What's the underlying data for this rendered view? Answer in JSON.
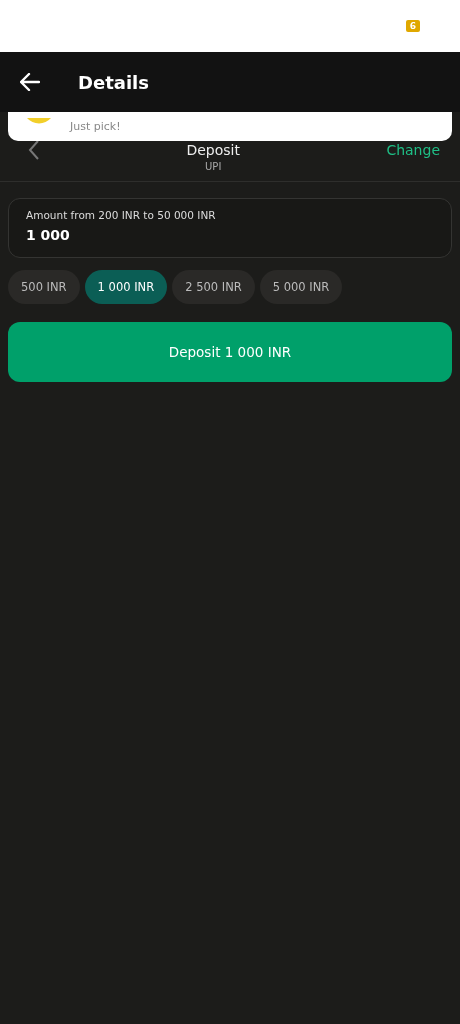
{
  "status_bar": {
    "badge": "6"
  },
  "app_bar": {
    "title": "Details"
  },
  "notification": {
    "text": "Just pick!"
  },
  "header": {
    "title": "Deposit",
    "subtitle": "UPI",
    "action": "Change"
  },
  "amount_field": {
    "label": "Amount from 200 INR to 50 000 INR",
    "value": "1 000"
  },
  "presets": [
    {
      "label": "500 INR",
      "selected": false
    },
    {
      "label": "1 000 INR",
      "selected": true
    },
    {
      "label": "2 500 INR",
      "selected": false
    },
    {
      "label": "5 000 INR",
      "selected": false
    }
  ],
  "submit": {
    "label": "Deposit 1 000 INR"
  }
}
